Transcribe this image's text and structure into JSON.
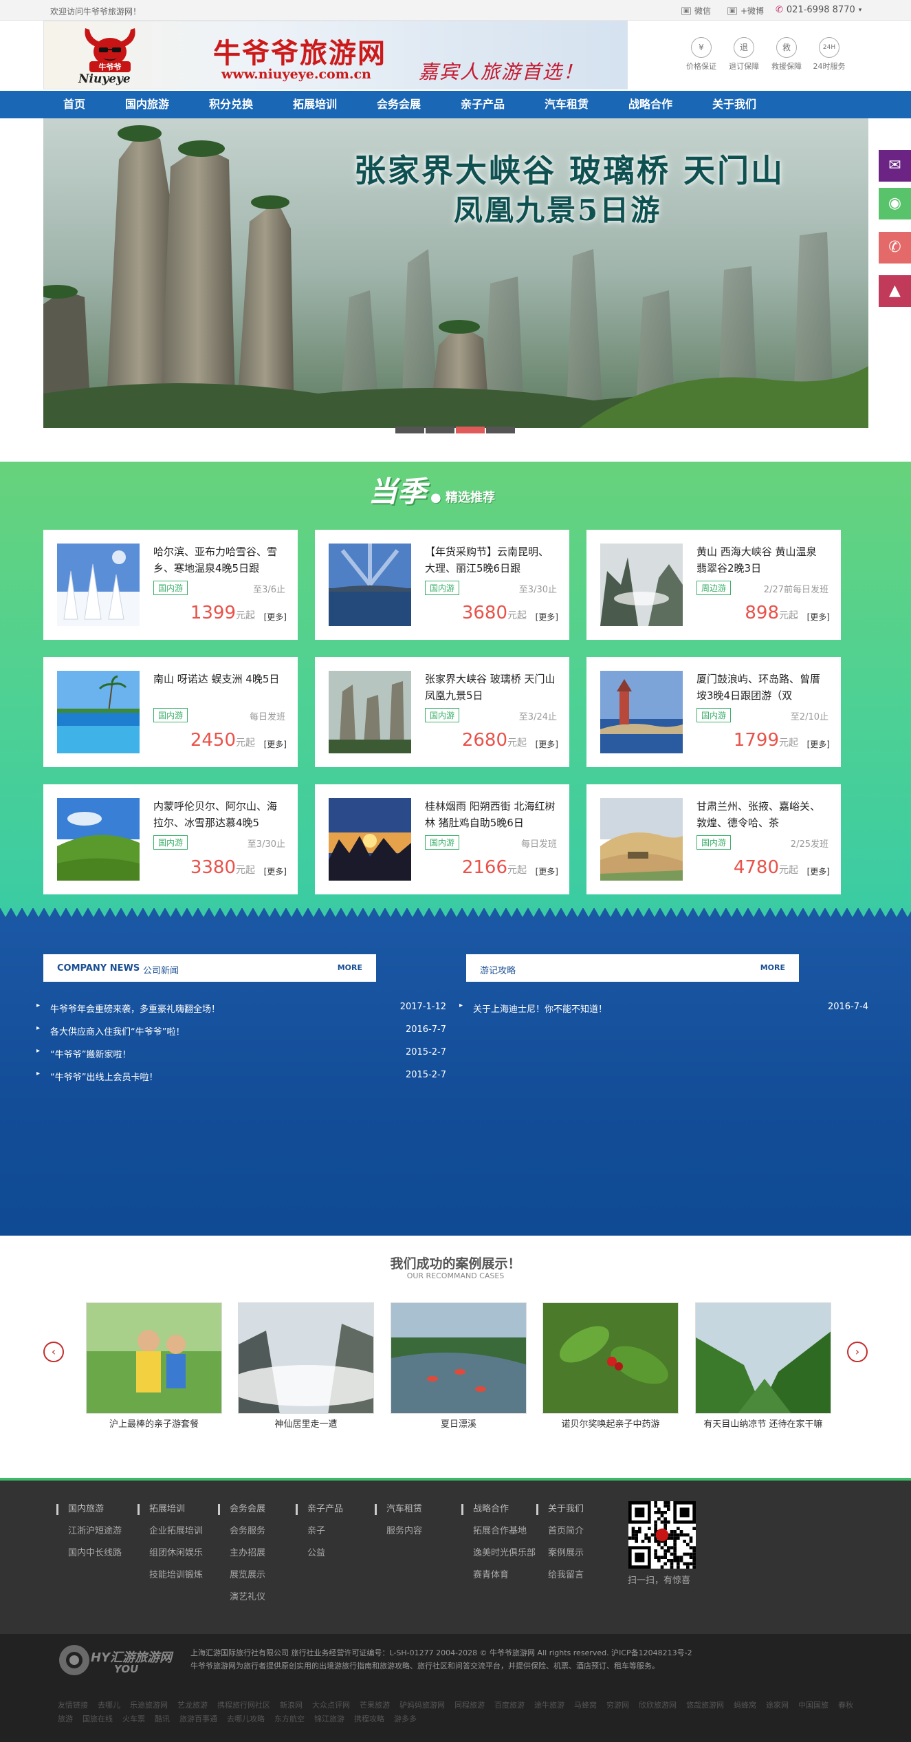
{
  "topbar": {
    "welcome": "欢迎访问牛爷爷旅游网！",
    "wechat": "微信",
    "weibo": "+微博",
    "phone": "021-6998 8770"
  },
  "header": {
    "logo_en": "Niuyeye",
    "logo_cn": "牛爷爷旅游网",
    "url": "www.niuyeye.com.cn",
    "slogan": "嘉宾人旅游首选！",
    "guarantees": [
      {
        "icon": "¥",
        "label": "价格保证"
      },
      {
        "icon": "退",
        "label": "退订保障"
      },
      {
        "icon": "救",
        "label": "救援保障"
      },
      {
        "icon": "24H",
        "label": "24时服务"
      }
    ]
  },
  "nav": [
    "首页",
    "国内旅游",
    "积分兑换",
    "拓展培训",
    "会务会展",
    "亲子产品",
    "汽车租赁",
    "战略合作",
    "关于我们"
  ],
  "hero": {
    "line1": "张家界大峡谷 玻璃桥 天门山",
    "line2": "凤凰九景5日游",
    "active_slide": 3,
    "slides": 4
  },
  "season": {
    "title": "当季",
    "subtitle": "● 精选推荐"
  },
  "cards": [
    {
      "title": "哈尔滨、亚布力哈雪谷、雪乡、寒地温泉4晚5日跟",
      "tag": "国内游",
      "dep": "至3/6止",
      "price": "1399",
      "unit": "元起",
      "more": "[更多]",
      "scene": "snow"
    },
    {
      "title": "【年货采购节】云南昆明、大理、丽江5晚6日跟",
      "tag": "国内游",
      "dep": "至3/30止",
      "price": "3680",
      "unit": "元起",
      "more": "[更多]",
      "scene": "lake"
    },
    {
      "title": "黄山 西海大峡谷 黄山温泉 翡翠谷2晚3日",
      "tag": "周边游",
      "dep": "2/27前每日发班",
      "price": "898",
      "unit": "元起",
      "more": "[更多]",
      "scene": "mountain"
    },
    {
      "title": "南山 呀诺达 蜈支洲 4晚5日",
      "tag": "国内游",
      "dep": "每日发班",
      "price": "2450",
      "unit": "元起",
      "more": "[更多]",
      "scene": "beach"
    },
    {
      "title": "张家界大峡谷 玻璃桥 天门山 凤凰九景5日",
      "tag": "国内游",
      "dep": "至3/24止",
      "price": "2680",
      "unit": "元起",
      "more": "[更多]",
      "scene": "karst"
    },
    {
      "title": "厦门鼓浪屿、环岛路、曾厝垵3晚4日跟团游（双",
      "tag": "国内游",
      "dep": "至2/10止",
      "price": "1799",
      "unit": "元起",
      "more": "[更多]",
      "scene": "coast"
    },
    {
      "title": "内蒙呼伦贝尔、阿尔山、海拉尔、冰雪那达慕4晚5",
      "tag": "国内游",
      "dep": "至3/30止",
      "price": "3380",
      "unit": "元起",
      "more": "[更多]",
      "scene": "grass"
    },
    {
      "title": "桂林烟雨 阳朔西街 北海红树林 猪肚鸡自助5晚6日",
      "tag": "国内游",
      "dep": "每日发班",
      "price": "2166",
      "unit": "元起",
      "more": "[更多]",
      "scene": "sunset"
    },
    {
      "title": "甘肃兰州、张掖、嘉峪关、敦煌、德令哈、茶",
      "tag": "国内游",
      "dep": "2/25发班",
      "price": "4780",
      "unit": "元起",
      "more": "[更多]",
      "scene": "desert"
    }
  ],
  "news": {
    "company": {
      "head_en": "COMPANY NEWS",
      "head_cn": "公司新闻",
      "more": "MORE",
      "items": [
        {
          "title": "牛爷爷年会重磅来袭，多重豪礼嗨翻全场！",
          "date": "2017-1-12"
        },
        {
          "title": "各大供应商入住我们“牛爷爷”啦！",
          "date": "2016-7-7"
        },
        {
          "title": "“牛爷爷”搬新家啦！",
          "date": "2015-2-7"
        },
        {
          "title": "“牛爷爷”出线上会员卡啦！",
          "date": "2015-2-7"
        }
      ]
    },
    "travel": {
      "head_cn": "游记攻略",
      "more": "MORE",
      "items": [
        {
          "title": "关于上海迪士尼！你不能不知道！",
          "date": "2016-7-4"
        }
      ]
    }
  },
  "cases": {
    "title": "我们成功的案例展示！",
    "subtitle": "OUR RECOMMAND CASES",
    "items": [
      {
        "caption": "沪上最棒的亲子游套餐",
        "scene": "family"
      },
      {
        "caption": "神仙居里走一遭",
        "scene": "mist"
      },
      {
        "caption": "夏日漂溪",
        "scene": "river"
      },
      {
        "caption": "诺贝尔奖唤起亲子中药游",
        "scene": "plant"
      },
      {
        "caption": "有天目山纳凉节 还待在家干嘛",
        "scene": "valley"
      }
    ]
  },
  "footer": {
    "columns": [
      {
        "head": "国内旅游",
        "items": [
          "江浙沪短途游",
          "国内中长线路"
        ]
      },
      {
        "head": "拓展培训",
        "items": [
          "企业拓展培训",
          "组团休闲娱乐",
          "技能培训锻炼"
        ]
      },
      {
        "head": "会务会展",
        "items": [
          "会务服务",
          "主办招展",
          "展览展示",
          "演艺礼仪"
        ]
      },
      {
        "head": "亲子产品",
        "items": [
          "亲子",
          "公益"
        ]
      },
      {
        "head": "汽车租赁",
        "items": [
          "服务内容"
        ]
      },
      {
        "head": "战略合作",
        "items": [
          "拓展合作基地",
          "逸美时光俱乐部",
          "赛青体育"
        ]
      },
      {
        "head": "关于我们",
        "items": [
          "首页简介",
          "案例展示",
          "给我留言"
        ]
      }
    ],
    "qr_caption": "扫一扫，有惊喜",
    "logo_text": "HY汇游旅游网",
    "logo_sub": "YOU",
    "copyright": "上海汇游国际旅行社有限公司 旅行社业务经营许可证编号：L-SH-01277 2004-2028 © 牛爷爷旅游网 All rights reserved. 沪ICP备12048213号-2",
    "desc": "牛爷爷旅游网为旅行者提供原创实用的出境游旅行指南和旅游攻略、旅行社区和问答交流平台，并提供保险、机票、酒店预订、租车等服务。",
    "links_label": "友情链接",
    "links": [
      "去哪儿",
      "乐途旅游网",
      "艺龙旅游",
      "携程旅行网社区",
      "新浪网",
      "大众点评网",
      "芒果旅游",
      "驴妈妈旅游网",
      "同程旅游",
      "百度旅游",
      "途牛旅游",
      "马蜂窝",
      "穷游网",
      "欣欣旅游网",
      "悠哉旅游网",
      "蚂蜂窝",
      "途家网",
      "中国国旅",
      "春秋旅游",
      "国旅在线",
      "火车票",
      "酷讯",
      "旅游百事通",
      "去哪儿攻略",
      "东方航空",
      "锦江旅游",
      "携程攻略",
      "游多多"
    ]
  }
}
